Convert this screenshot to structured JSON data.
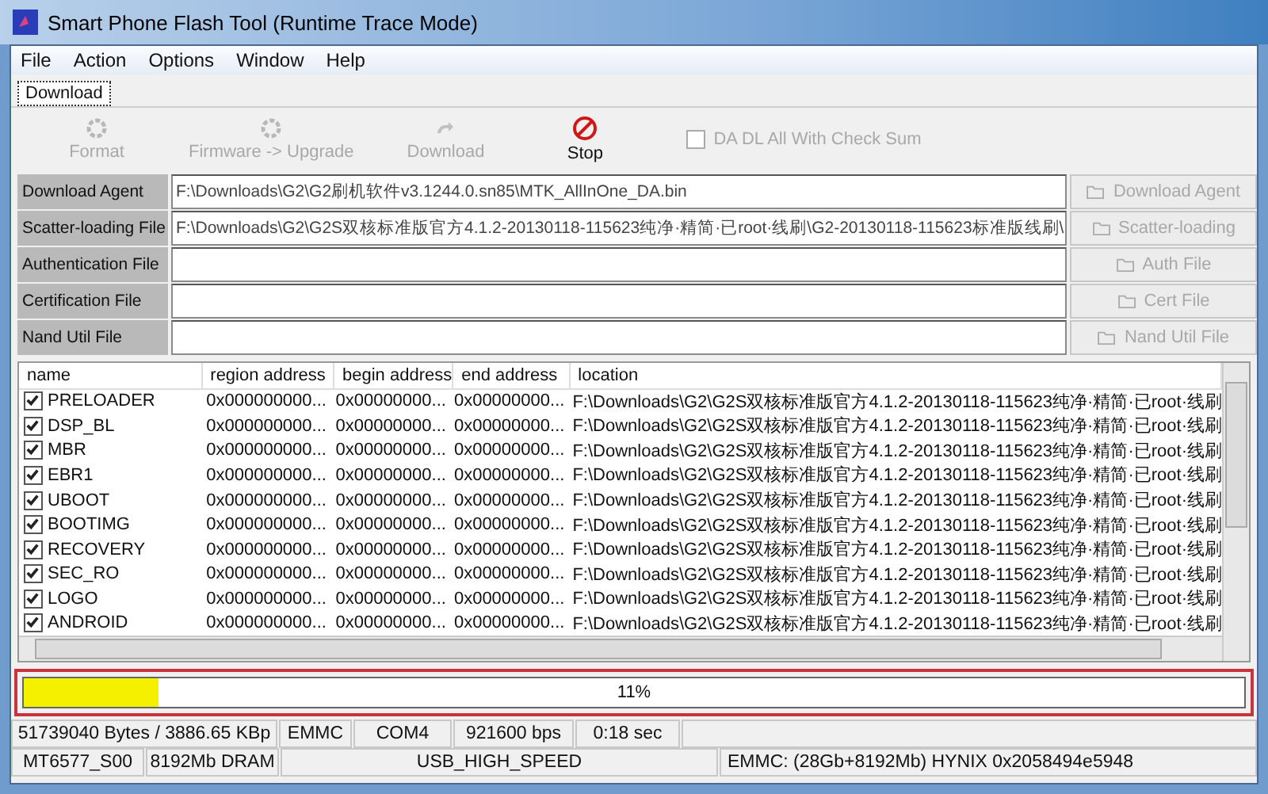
{
  "window": {
    "title": "Smart Phone Flash Tool (Runtime Trace Mode)"
  },
  "menu": [
    "File",
    "Action",
    "Options",
    "Window",
    "Help"
  ],
  "tabs": [
    {
      "label": "Download",
      "selected": true
    }
  ],
  "toolbar": {
    "buttons": [
      {
        "label": "Format",
        "kind": "gear",
        "disabled": true
      },
      {
        "label": "Firmware -> Upgrade",
        "kind": "gear",
        "disabled": true
      },
      {
        "label": "Download",
        "kind": "arrow",
        "disabled": true
      },
      {
        "label": "Stop",
        "kind": "stop",
        "disabled": false
      }
    ],
    "checksum": {
      "label": "DA DL All With Check Sum",
      "checked": false,
      "disabled": true
    }
  },
  "files": [
    {
      "label": "Download Agent",
      "value": "F:\\Downloads\\G2\\G2刷机软件v3.1244.0.sn85\\MTK_AllInOne_DA.bin",
      "button": "Download Agent",
      "disabled": true
    },
    {
      "label": "Scatter-loading File",
      "value": "F:\\Downloads\\G2\\G2S双核标准版官方4.1.2-20130118-115623纯净·精简·已root·线刷\\G2-20130118-115623标准版线刷\\",
      "button": "Scatter-loading",
      "disabled": true
    },
    {
      "label": "Authentication File",
      "button": "Auth File",
      "disabled": true
    },
    {
      "label": "Certification File",
      "button": "Cert File",
      "disabled": true
    },
    {
      "label": "Nand Util File",
      "button": "Nand Util File",
      "disabled": true
    }
  ],
  "table": {
    "columns": [
      "name",
      "region address",
      "begin address",
      "end address",
      "location"
    ],
    "rows": [
      {
        "name": "PRELOADER",
        "checked": true,
        "region_address": "0x000000000...",
        "begin_address": "0x00000000...",
        "end_address": "0x00000000...",
        "location": "F:\\Downloads\\G2\\G2S双核标准版官方4.1.2-20130118-115623纯净·精简·已root·线刷"
      },
      {
        "name": "DSP_BL",
        "checked": true,
        "region_address": "0x000000000...",
        "begin_address": "0x00000000...",
        "end_address": "0x00000000...",
        "location": "F:\\Downloads\\G2\\G2S双核标准版官方4.1.2-20130118-115623纯净·精简·已root·线刷"
      },
      {
        "name": "MBR",
        "checked": true,
        "region_address": "0x000000000...",
        "begin_address": "0x00000000...",
        "end_address": "0x00000000...",
        "location": "F:\\Downloads\\G2\\G2S双核标准版官方4.1.2-20130118-115623纯净·精简·已root·线刷"
      },
      {
        "name": "EBR1",
        "checked": true,
        "region_address": "0x000000000...",
        "begin_address": "0x00000000...",
        "end_address": "0x00000000...",
        "location": "F:\\Downloads\\G2\\G2S双核标准版官方4.1.2-20130118-115623纯净·精简·已root·线刷"
      },
      {
        "name": "UBOOT",
        "checked": true,
        "region_address": "0x000000000...",
        "begin_address": "0x00000000...",
        "end_address": "0x00000000...",
        "location": "F:\\Downloads\\G2\\G2S双核标准版官方4.1.2-20130118-115623纯净·精简·已root·线刷"
      },
      {
        "name": "BOOTIMG",
        "checked": true,
        "region_address": "0x000000000...",
        "begin_address": "0x00000000...",
        "end_address": "0x00000000...",
        "location": "F:\\Downloads\\G2\\G2S双核标准版官方4.1.2-20130118-115623纯净·精简·已root·线刷"
      },
      {
        "name": "RECOVERY",
        "checked": true,
        "region_address": "0x000000000...",
        "begin_address": "0x00000000...",
        "end_address": "0x00000000...",
        "location": "F:\\Downloads\\G2\\G2S双核标准版官方4.1.2-20130118-115623纯净·精简·已root·线刷"
      },
      {
        "name": "SEC_RO",
        "checked": true,
        "region_address": "0x000000000...",
        "begin_address": "0x00000000...",
        "end_address": "0x00000000...",
        "location": "F:\\Downloads\\G2\\G2S双核标准版官方4.1.2-20130118-115623纯净·精简·已root·线刷"
      },
      {
        "name": "LOGO",
        "checked": true,
        "region_address": "0x000000000...",
        "begin_address": "0x00000000...",
        "end_address": "0x00000000...",
        "location": "F:\\Downloads\\G2\\G2S双核标准版官方4.1.2-20130118-115623纯净·精简·已root·线刷"
      },
      {
        "name": "ANDROID",
        "checked": true,
        "region_address": "0x000000000...",
        "begin_address": "0x00000000...",
        "end_address": "0x00000000...",
        "location": "F:\\Downloads\\G2\\G2S双核标准版官方4.1.2-20130118-115623纯净·精简·已root·线刷"
      }
    ]
  },
  "progress": {
    "level": 0.11,
    "label": "11%"
  },
  "status_bar": {
    "row_1": [
      "51739040 Bytes / 3886.65 KBp",
      "EMMC",
      "COM4",
      "921600 bps",
      "0:18 sec"
    ],
    "row_2": [
      "MT6577_S00",
      "8192Mb DRAM",
      "USB_HIGH_SPEED",
      "EMMC: (28Gb+8192Mb) HYNIX 0x2058494e5948"
    ]
  }
}
